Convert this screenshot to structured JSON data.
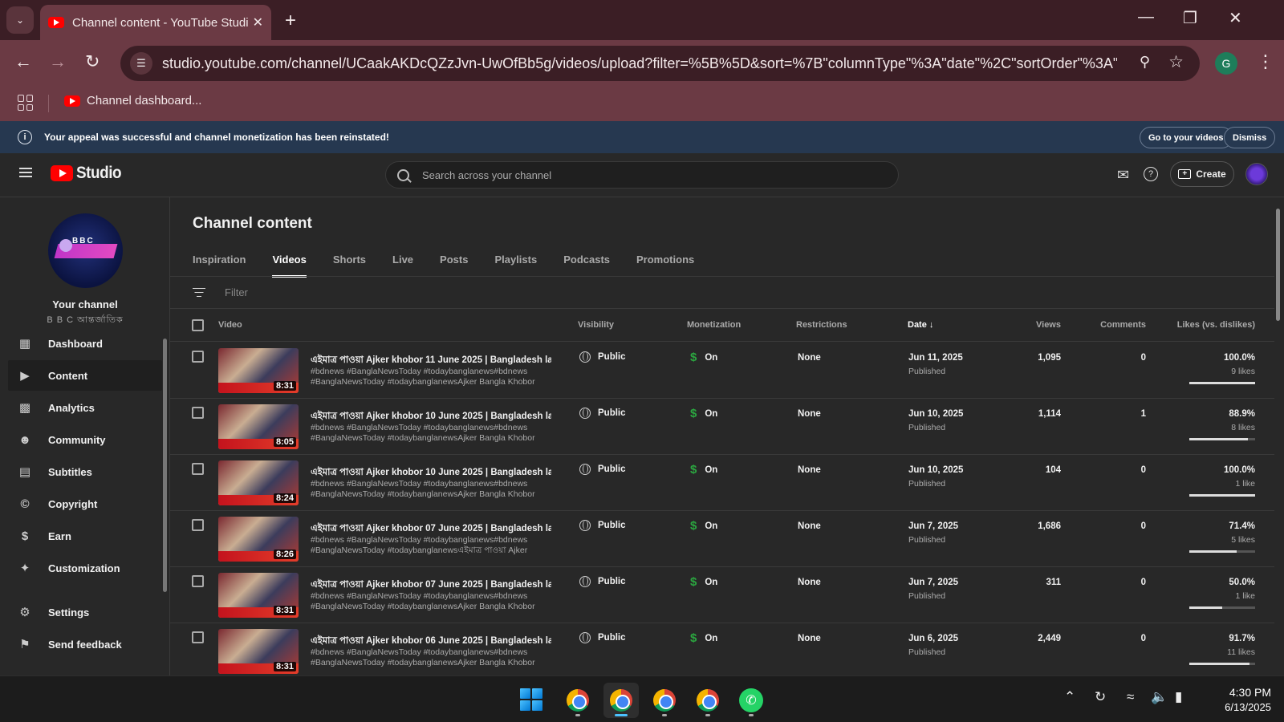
{
  "browser": {
    "tab_title": "Channel content - YouTube Studio",
    "url": "studio.youtube.com/channel/UCaakAKDcQZzJvn-UwOfBb5g/videos/upload?filter=%5B%5D&sort=%7B\"columnType\"%3A\"date\"%2C\"sortOrder\"%3A\"DES...",
    "profile_initial": "G",
    "bookmark_label": "Channel dashboard..."
  },
  "banner": {
    "message": "Your appeal was successful and channel monetization has been reinstated!",
    "go_label": "Go to your videos",
    "dismiss_label": "Dismiss"
  },
  "header": {
    "logo_text": "Studio",
    "search_placeholder": "Search across your channel",
    "create_label": "Create"
  },
  "sidebar": {
    "avatar_text": "BBC",
    "channel_label": "Your channel",
    "channel_name": "B B C আন্তর্জাতিক",
    "items": [
      {
        "label": "Dashboard",
        "icon": "dashboard-icon"
      },
      {
        "label": "Content",
        "icon": "content-icon"
      },
      {
        "label": "Analytics",
        "icon": "analytics-icon"
      },
      {
        "label": "Community",
        "icon": "community-icon"
      },
      {
        "label": "Subtitles",
        "icon": "subtitles-icon"
      },
      {
        "label": "Copyright",
        "icon": "copyright-icon"
      },
      {
        "label": "Earn",
        "icon": "earn-icon"
      },
      {
        "label": "Customization",
        "icon": "customization-icon"
      }
    ],
    "settings_label": "Settings",
    "feedback_label": "Send feedback"
  },
  "main": {
    "title": "Channel content",
    "tabs": [
      "Inspiration",
      "Videos",
      "Shorts",
      "Live",
      "Posts",
      "Playlists",
      "Podcasts",
      "Promotions"
    ],
    "active_tab": "Videos",
    "filter_label": "Filter",
    "columns": {
      "video": "Video",
      "visibility": "Visibility",
      "monetization": "Monetization",
      "restrictions": "Restrictions",
      "date": "Date",
      "views": "Views",
      "comments": "Comments",
      "likes": "Likes (vs. dislikes)"
    },
    "rows": [
      {
        "title": "এইমাত্র পাওয়া Ajker khobor 11 June 2025 | Bangladesh latest...",
        "desc1": "#bdnews #BanglaNewsToday #todaybanglanews#bdnews",
        "desc2": "#BanglaNewsToday #todaybanglanewsAjker Bangla Khobor 11...",
        "duration": "8:31",
        "visibility": "Public",
        "monetization": "On",
        "restrictions": "None",
        "date": "Jun 11, 2025",
        "status": "Published",
        "views": "1,095",
        "comments": "0",
        "like_pct": "100.0%",
        "likes": "9 likes",
        "like_ratio": 1.0
      },
      {
        "title": "এইমাত্র পাওয়া Ajker khobor 10 June 2025 | Bangladesh latest...",
        "desc1": "#bdnews #BanglaNewsToday #todaybanglanews#bdnews",
        "desc2": "#BanglaNewsToday #todaybanglanewsAjker Bangla Khobor 10...",
        "duration": "8:05",
        "visibility": "Public",
        "monetization": "On",
        "restrictions": "None",
        "date": "Jun 10, 2025",
        "status": "Published",
        "views": "1,114",
        "comments": "1",
        "like_pct": "88.9%",
        "likes": "8 likes",
        "like_ratio": 0.889
      },
      {
        "title": "এইমাত্র পাওয়া Ajker khobor 10 June 2025 | Bangladesh latest...",
        "desc1": "#bdnews #BanglaNewsToday #todaybanglanews#bdnews",
        "desc2": "#BanglaNewsToday #todaybanglanewsAjker Bangla Khobor 10...",
        "duration": "8:24",
        "visibility": "Public",
        "monetization": "On",
        "restrictions": "None",
        "date": "Jun 10, 2025",
        "status": "Published",
        "views": "104",
        "comments": "0",
        "like_pct": "100.0%",
        "likes": "1 like",
        "like_ratio": 1.0
      },
      {
        "title": "এইমাত্র পাওয়া Ajker khobor 07 June 2025 | Bangladesh latest...",
        "desc1": "#bdnews #BanglaNewsToday #todaybanglanews#bdnews",
        "desc2": "#BanglaNewsToday #todaybanglanewsএইমাত্র পাওয়া Ajker khob...",
        "duration": "8:26",
        "visibility": "Public",
        "monetization": "On",
        "restrictions": "None",
        "date": "Jun 7, 2025",
        "status": "Published",
        "views": "1,686",
        "comments": "0",
        "like_pct": "71.4%",
        "likes": "5 likes",
        "like_ratio": 0.714
      },
      {
        "title": "এইমাত্র পাওয়া Ajker khobor 07 June 2025 | Bangladesh latest...",
        "desc1": "#bdnews #BanglaNewsToday #todaybanglanews#bdnews",
        "desc2": "#BanglaNewsToday #todaybanglanewsAjker Bangla Khobor 06...",
        "duration": "8:31",
        "visibility": "Public",
        "monetization": "On",
        "restrictions": "None",
        "date": "Jun 7, 2025",
        "status": "Published",
        "views": "311",
        "comments": "0",
        "like_pct": "50.0%",
        "likes": "1 like",
        "like_ratio": 0.5
      },
      {
        "title": "এইমাত্র পাওয়া Ajker khobor 06 June 2025 | Bangladesh latest...",
        "desc1": "#bdnews #BanglaNewsToday #todaybanglanews#bdnews",
        "desc2": "#BanglaNewsToday #todaybanglanewsAjker Bangla Khobor 06...",
        "duration": "8:31",
        "visibility": "Public",
        "monetization": "On",
        "restrictions": "None",
        "date": "Jun 6, 2025",
        "status": "Published",
        "views": "2,449",
        "comments": "0",
        "like_pct": "91.7%",
        "likes": "11 likes",
        "like_ratio": 0.917
      }
    ]
  },
  "taskbar": {
    "time": "4:30 PM",
    "date": "6/13/2025",
    "active_profile_initial": "G"
  },
  "colors": {
    "accent_red": "#ff0000",
    "monetization_green": "#2ba640",
    "banner_bg": "#263850",
    "browser_frame": "#6b3a44"
  }
}
